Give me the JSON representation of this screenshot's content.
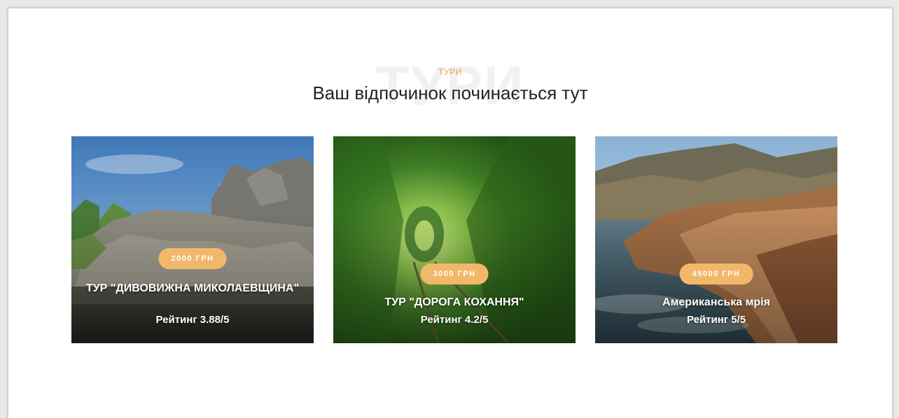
{
  "section": {
    "watermark": "ТУРИ",
    "eyebrow": "ТУРИ",
    "title": "Ваш відпочинок починається тут"
  },
  "tours": [
    {
      "price": "2000 ГРН",
      "name": "ТУР \"ДИВОВИЖНА МИКОЛАЕВЩИНА\"",
      "rating": "Рейтинг 3.88/5",
      "image": "rocky-lake-landscape"
    },
    {
      "price": "3000 ГРН",
      "name": "ТУР \"ДОРОГА КОХАННЯ\"",
      "rating": "Рейтинг 4.2/5",
      "image": "green-tunnel-of-love"
    },
    {
      "price": "45000 ГРН",
      "name": "Американська мрія",
      "rating": "Рейтинг 5/5",
      "image": "coastal-cliffs"
    }
  ],
  "colors": {
    "accent": "#f2b86a",
    "eyebrow": "#e8a33d",
    "title": "#222222"
  }
}
